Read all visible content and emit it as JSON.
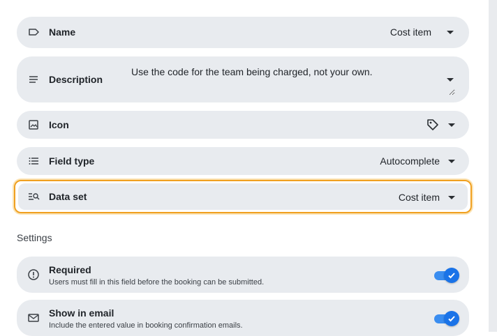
{
  "fields": {
    "name": {
      "label": "Name",
      "value": "Cost item"
    },
    "description": {
      "label": "Description",
      "value": "Use the code for the team being charged, not your own."
    },
    "icon": {
      "label": "Icon",
      "value_icon": "tag-icon"
    },
    "field_type": {
      "label": "Field type",
      "value": "Autocomplete"
    },
    "data_set": {
      "label": "Data set",
      "value": "Cost item"
    }
  },
  "settings": {
    "title": "Settings",
    "items": [
      {
        "label": "Required",
        "description": "Users must fill in this field before the booking can be submitted.",
        "enabled": true
      },
      {
        "label": "Show in email",
        "description": "Include the entered value in booking confirmation emails.",
        "enabled": true
      }
    ]
  },
  "colors": {
    "row_background": "#e8ebef",
    "focus_outline": "#f0a020",
    "toggle_on": "#1a73e8"
  }
}
